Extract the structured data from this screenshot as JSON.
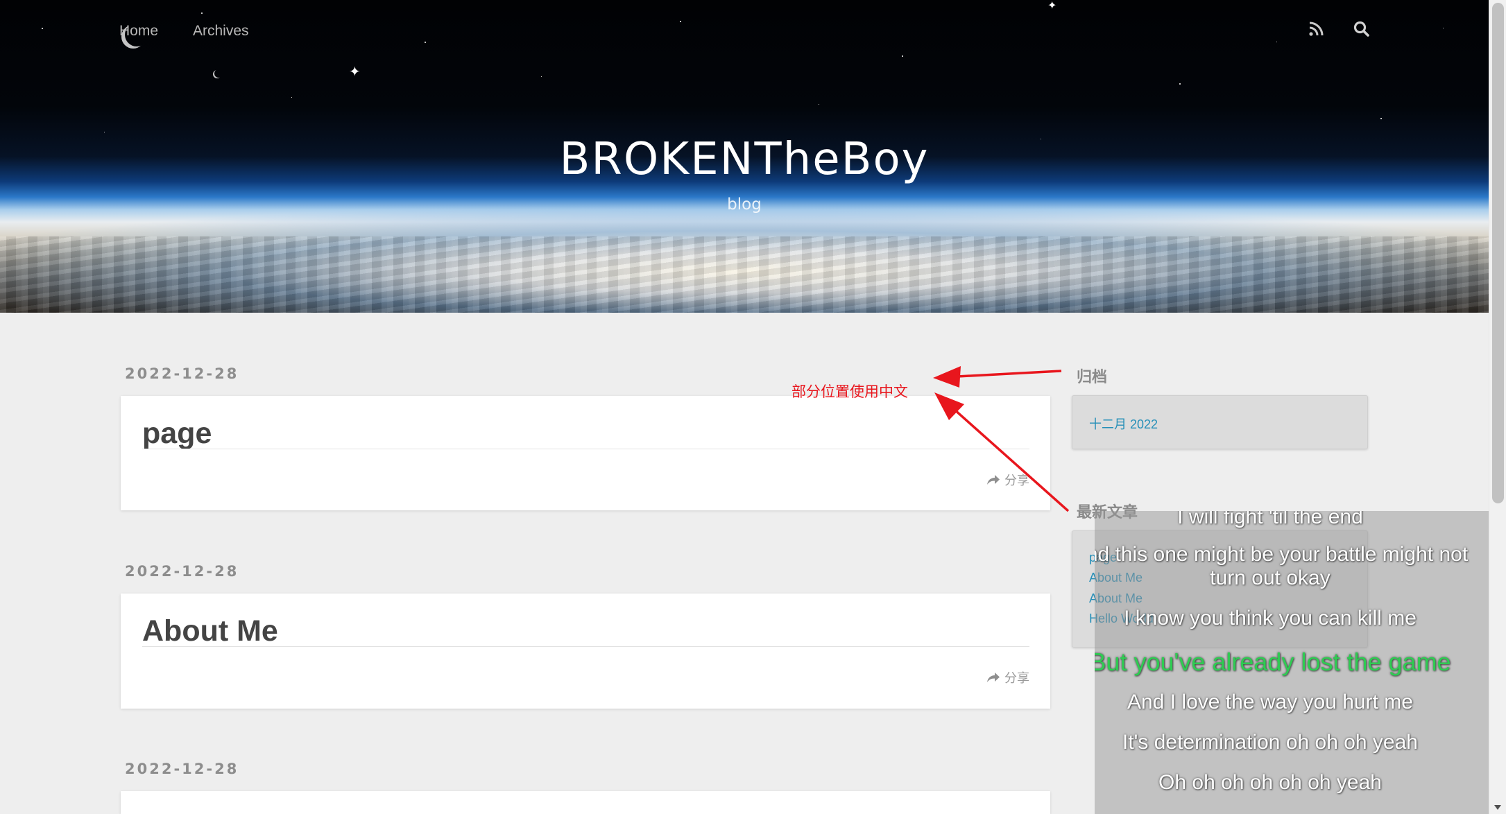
{
  "nav": {
    "links": [
      "Home",
      "Archives"
    ],
    "rss_icon": "rss-icon",
    "search_icon": "search-icon"
  },
  "header": {
    "title": "BROKENTheBoy",
    "subtitle": "blog"
  },
  "posts": [
    {
      "date": "2022-12-28",
      "title": "page",
      "share_label": "分享"
    },
    {
      "date": "2022-12-28",
      "title": "About Me",
      "share_label": "分享"
    },
    {
      "date": "2022-12-28",
      "title": "",
      "share_label": ""
    }
  ],
  "sidebar": {
    "archive": {
      "title": "归档",
      "items": [
        "十二月 2022"
      ]
    },
    "recent": {
      "title": "最新文章",
      "items": [
        "page",
        "About Me",
        "About Me",
        "Hello World"
      ]
    }
  },
  "annotation": {
    "text": "部分位置使用中文",
    "color": "#e8161d"
  },
  "lyrics": {
    "lines": [
      "I will fight 'til the end",
      "And this one might be your battle might not",
      "turn out okay",
      "I know you think you can kill me",
      "But you've already lost the game",
      "And I love the way you hurt me",
      "It's determination oh oh oh yeah",
      "Oh oh oh oh oh oh yeah"
    ],
    "current_index": 4,
    "current_color": "#2ecc52"
  },
  "colors": {
    "link": "#258fb8",
    "page_bg": "#eeeeee"
  }
}
